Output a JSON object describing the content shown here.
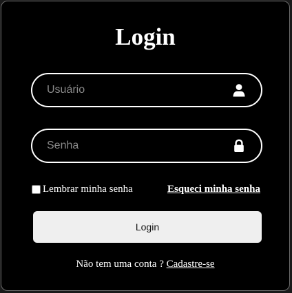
{
  "form": {
    "title": "Login",
    "username": {
      "placeholder": "Usuário",
      "value": "",
      "icon": "user-icon"
    },
    "password": {
      "placeholder": "Senha",
      "value": "",
      "icon": "lock-icon"
    },
    "remember_label": "Lembrar minha senha",
    "remember_checked": false,
    "forgot_label": "Esqueci minha senha",
    "submit_label": "Login",
    "signup_prompt": "Não tem uma conta ? ",
    "signup_link": "Cadastre-se"
  },
  "colors": {
    "background": "#000000",
    "border": "#ffffff",
    "button": "#efefef",
    "placeholder": "#8a8a8a"
  }
}
